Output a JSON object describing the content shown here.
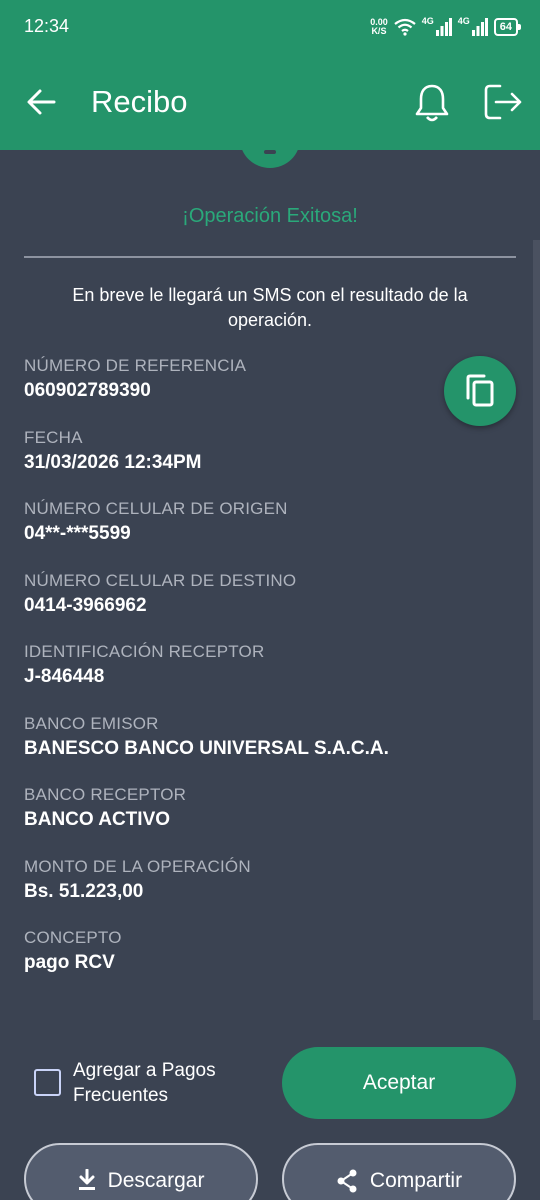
{
  "status_bar": {
    "time": "12:34",
    "net_speed_value": "0.00",
    "net_speed_unit": "K/S",
    "signal1_label": "4G",
    "signal2_label": "4G",
    "battery": "64"
  },
  "header": {
    "title": "Recibo"
  },
  "receipt": {
    "success_message": "¡Operación Exitosa!",
    "sms_message": "En breve le llegará un SMS con el resultado de la operación.",
    "fields": [
      {
        "label": "NÚMERO DE REFERENCIA",
        "value": "060902789390"
      },
      {
        "label": "FECHA",
        "value": "31/03/2026 12:34PM"
      },
      {
        "label": "NÚMERO CELULAR DE ORIGEN",
        "value": "04**-***5599"
      },
      {
        "label": "NÚMERO CELULAR DE DESTINO",
        "value": "0414-3966962"
      },
      {
        "label": "IDENTIFICACIÓN RECEPTOR",
        "value": "J-846448"
      },
      {
        "label": "BANCO EMISOR",
        "value": "BANESCO BANCO UNIVERSAL S.A.C.A."
      },
      {
        "label": "BANCO RECEPTOR",
        "value": "BANCO ACTIVO"
      },
      {
        "label": "MONTO DE LA OPERACIÓN",
        "value": "Bs. 51.223,00"
      },
      {
        "label": "CONCEPTO",
        "value": "pago RCV"
      }
    ]
  },
  "actions": {
    "frequent_label": "Agregar a Pagos Frecuentes",
    "accept_label": "Aceptar",
    "download_label": "Descargar",
    "share_label": "Compartir"
  },
  "colors": {
    "primary_green": "#24946a",
    "background": "#3b4352",
    "success_text": "#2aa97a"
  },
  "icons": [
    "back-arrow-icon",
    "bell-icon",
    "logout-icon",
    "copy-icon",
    "download-icon",
    "share-icon",
    "wifi-icon",
    "signal-icon",
    "battery-icon"
  ]
}
